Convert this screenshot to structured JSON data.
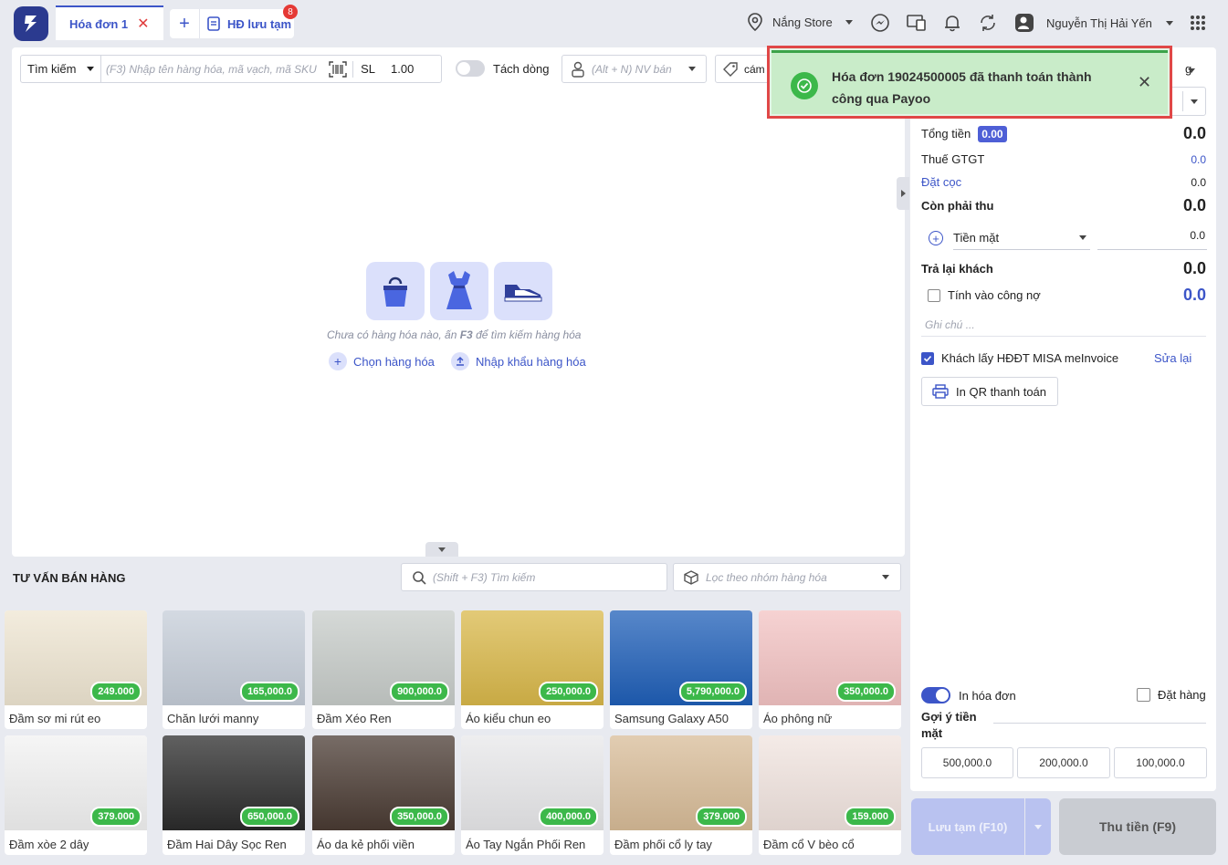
{
  "header": {
    "active_tab": "Hóa đơn 1",
    "saved_tab": "HĐ lưu tạm",
    "saved_count": "8",
    "store": "Nắng Store",
    "user": "Nguyễn Thị Hải Yến"
  },
  "toolbar": {
    "search_mode": "Tìm kiếm",
    "search_placeholder": "(F3) Nhập tên hàng hóa, mã vạch, mã SKU",
    "qty_label": "SL",
    "qty_value": "1.00",
    "split_label": "Tách dòng",
    "staff_placeholder": "(Alt + N) NV bán",
    "tag_text": "cám"
  },
  "empty_state": {
    "message_pre": "Chưa có hàng hóa nào, ấn ",
    "message_key": "F3",
    "message_post": " để tìm kiếm hàng hóa",
    "choose": "Chọn hàng hóa",
    "import": "Nhập khẩu hàng hóa"
  },
  "advice": {
    "title": "TƯ VẤN BÁN HÀNG",
    "search_placeholder": "(Shift + F3) Tìm kiếm",
    "filter_placeholder": "Lọc theo nhóm hàng hóa"
  },
  "products": [
    {
      "name": "Đầm sơ mi rút eo",
      "price": "249.000",
      "color": "#efe6d2"
    },
    {
      "name": "Chăn lưới manny",
      "price": "165,000.0",
      "color": "#c5cdd8"
    },
    {
      "name": "Đầm Xéo Ren",
      "price": "900,000.0",
      "color": "#c7ccc9"
    },
    {
      "name": "Áo kiểu chun eo",
      "price": "250,000.0",
      "color": "#d9b84a"
    },
    {
      "name": "Samsung Galaxy A50",
      "price": "5,790,000.0",
      "color": "#1f5fb8"
    },
    {
      "name": "Áo phông nữ",
      "price": "350,000.0",
      "color": "#f3c3c3"
    },
    {
      "name": "Đầm xòe 2 dây",
      "price": "379.000",
      "color": "#f2f2f2"
    },
    {
      "name": "Đầm Hai Dây Sọc Ren",
      "price": "650,000.0",
      "color": "#2b2b2b"
    },
    {
      "name": "Áo da kẻ phối viền",
      "price": "350,000.0",
      "color": "#4a3b33"
    },
    {
      "name": "Áo Tay Ngắn Phối Ren",
      "price": "400,000.0",
      "color": "#e8e8ea"
    },
    {
      "name": "Đầm phối cổ ly tay",
      "price": "379.000",
      "color": "#d8bc98"
    },
    {
      "name": "Đầm cổ V bèo cổ",
      "price": "159.000",
      "color": "#f1e4df"
    }
  ],
  "summary": {
    "total_label": "Tổng tiền",
    "total_badge": "0.00",
    "total_value": "0.0",
    "vat_label": "Thuế GTGT",
    "vat_value": "0.0",
    "deposit_label": "Đặt cọc",
    "deposit_value": "0.0",
    "due_label": "Còn phải thu",
    "due_value": "0.0",
    "method": "Tiền mặt",
    "method_value": "0.0",
    "change_label": "Trả lại khách",
    "change_value": "0.0",
    "debt_label": "Tính vào công nợ",
    "debt_value": "0.0",
    "note_placeholder": "Ghi chú ...",
    "einvoice_label": "Khách lấy HĐĐT MISA meInvoice",
    "edit_link": "Sửa lại",
    "qr_button": "In QR thanh toán",
    "print_label": "In hóa đơn",
    "order_label": "Đặt hàng",
    "suggest_label_1": "Gợi ý tiền",
    "suggest_label_2": "mặt",
    "suggestions": [
      "500,000.0",
      "200,000.0",
      "100,000.0"
    ],
    "save_button": "Lưu tạm (F10)",
    "pay_button": "Thu tiền (F9)",
    "hidden_tab_tail": "g"
  },
  "toast": {
    "message_line1": "Hóa đơn 19024500005 đã thanh toán thành",
    "message_line2": "công qua Payoo"
  }
}
